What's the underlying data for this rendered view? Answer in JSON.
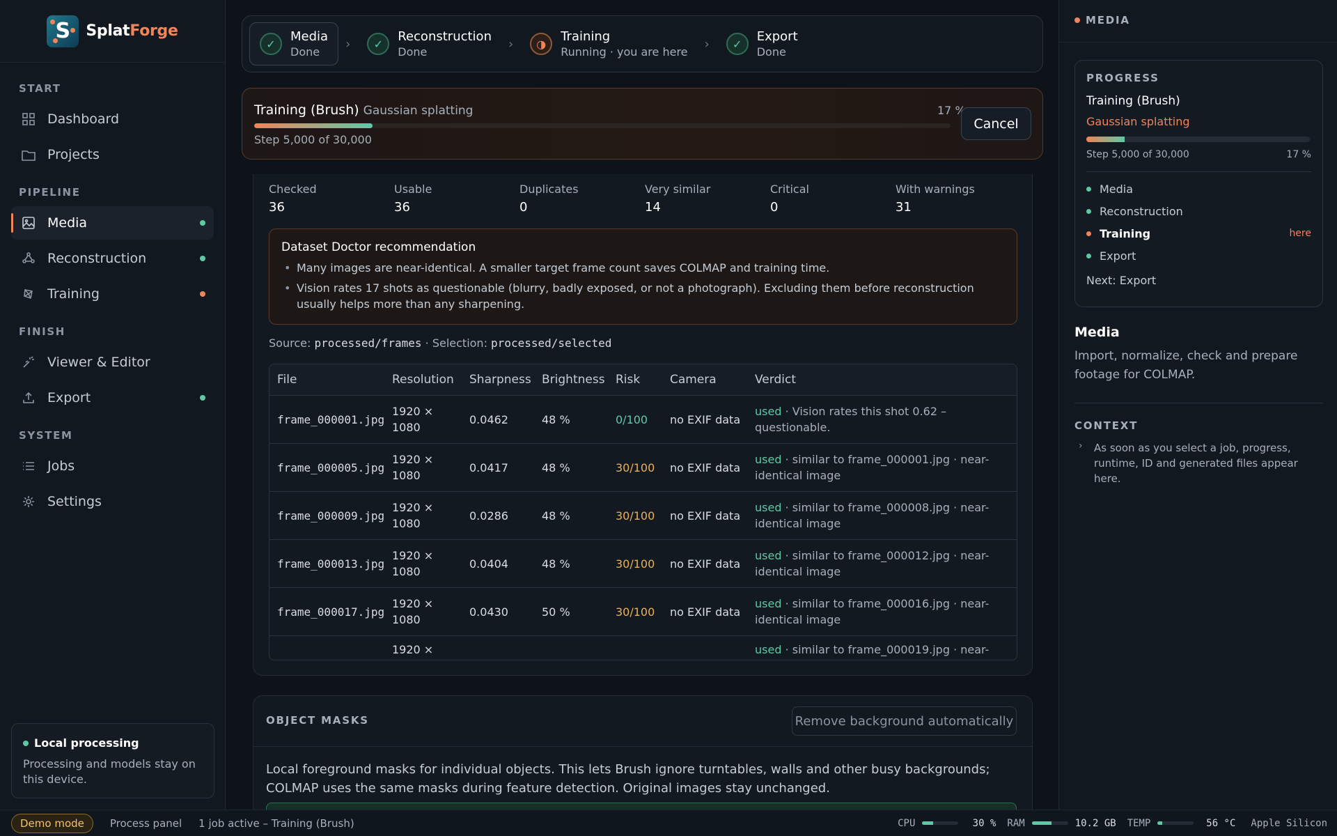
{
  "app": {
    "name_a": "Splat",
    "name_b": "Forge",
    "logo_letter": "S"
  },
  "sidebar": {
    "sections": {
      "start": "START",
      "pipeline": "PIPELINE",
      "finish": "FINISH",
      "system": "SYSTEM"
    },
    "items": [
      {
        "label": "Dashboard",
        "icon": "grid-icon"
      },
      {
        "label": "Projects",
        "icon": "folder-icon"
      },
      {
        "label": "Media",
        "icon": "image-icon",
        "status": "done"
      },
      {
        "label": "Reconstruction",
        "icon": "nodes-icon",
        "status": "done"
      },
      {
        "label": "Training",
        "icon": "brain-icon",
        "status": "running"
      },
      {
        "label": "Viewer & Editor",
        "icon": "wand-icon"
      },
      {
        "label": "Export",
        "icon": "upload-icon",
        "status": "done"
      },
      {
        "label": "Jobs",
        "icon": "list-icon"
      },
      {
        "label": "Settings",
        "icon": "gear-icon"
      }
    ],
    "local": {
      "title": "Local processing",
      "text": "Processing and models stay on this device."
    }
  },
  "stepper": [
    {
      "title": "Media",
      "status": "Done"
    },
    {
      "title": "Reconstruction",
      "status": "Done"
    },
    {
      "title": "Training",
      "status": "Running · you are here"
    },
    {
      "title": "Export",
      "status": "Done"
    }
  ],
  "training": {
    "title": "Training (Brush)",
    "subtitle": "Gaussian splatting",
    "percent_label": "17 %",
    "progress": 0.17,
    "step": "Step 5,000 of 30,000",
    "cancel": "Cancel"
  },
  "stats": [
    {
      "label": "Checked",
      "value": "36"
    },
    {
      "label": "Usable",
      "value": "36"
    },
    {
      "label": "Duplicates",
      "value": "0"
    },
    {
      "label": "Very similar",
      "value": "14"
    },
    {
      "label": "Critical",
      "value": "0"
    },
    {
      "label": "With warnings",
      "value": "31"
    }
  ],
  "doctor": {
    "title": "Dataset Doctor recommendation",
    "items": [
      "Many images are near-identical. A smaller target frame count saves COLMAP and training time.",
      "Vision rates 17 shots as questionable (blurry, badly exposed, or not a photograph). Excluding them before reconstruction usually helps more than any sharpening."
    ]
  },
  "source": {
    "source_label": "Source:",
    "source_path": "processed/frames",
    "sep": "· Selection:",
    "selection_path": "processed/selected"
  },
  "table": {
    "headers": [
      "File",
      "Resolution",
      "Sharpness",
      "Brightness",
      "Risk",
      "Camera",
      "Verdict"
    ],
    "rows": [
      {
        "file": "frame_000001.jpg",
        "res1": "1920 ×",
        "res2": "1080",
        "sharp": "0.0462",
        "bright": "48 %",
        "risk": "0/100",
        "camera": "no EXIF data",
        "verdict": "used",
        "note": " · Vision rates this shot 0.62 – questionable."
      },
      {
        "file": "frame_000005.jpg",
        "res1": "1920 ×",
        "res2": "1080",
        "sharp": "0.0417",
        "bright": "48 %",
        "risk": "30/100",
        "camera": "no EXIF data",
        "verdict": "used",
        "note": " · similar to frame_000001.jpg · near-identical image"
      },
      {
        "file": "frame_000009.jpg",
        "res1": "1920 ×",
        "res2": "1080",
        "sharp": "0.0286",
        "bright": "48 %",
        "risk": "30/100",
        "camera": "no EXIF data",
        "verdict": "used",
        "note": " · similar to frame_000008.jpg · near-identical image"
      },
      {
        "file": "frame_000013.jpg",
        "res1": "1920 ×",
        "res2": "1080",
        "sharp": "0.0404",
        "bright": "48 %",
        "risk": "30/100",
        "camera": "no EXIF data",
        "verdict": "used",
        "note": " · similar to frame_000012.jpg · near-identical image"
      },
      {
        "file": "frame_000017.jpg",
        "res1": "1920 ×",
        "res2": "1080",
        "sharp": "0.0430",
        "bright": "50 %",
        "risk": "30/100",
        "camera": "no EXIF data",
        "verdict": "used",
        "note": " · similar to frame_000016.jpg · near-identical image"
      },
      {
        "file": "",
        "res1": "1920 ×",
        "res2": "",
        "sharp": "",
        "bright": "",
        "risk": "",
        "camera": "",
        "verdict": "used",
        "note": " · similar to frame_000019.jpg · near-"
      }
    ]
  },
  "masks": {
    "title": "OBJECT MASKS",
    "button": "Remove background automatically",
    "text": "Local foreground masks for individual objects. This lets Brush ignore turntables, walls and other busy backgrounds; COLMAP uses the same masks during feature detection. Original images stay unchanged."
  },
  "right": {
    "header": "MEDIA",
    "progress_title": "PROGRESS",
    "job": "Training (Brush)",
    "job_sub": "Gaussian splatting",
    "progress": 0.17,
    "step": "Step 5,000 of 30,000",
    "pct": "17 %",
    "stages": [
      "Media",
      "Reconstruction",
      "Training",
      "Export"
    ],
    "here": "here",
    "next": "Next: Export",
    "media_title": "Media",
    "media_desc": "Import, normalize, check and prepare footage for COLMAP.",
    "context_title": "CONTEXT",
    "context_text": "As soon as you select a job, progress, runtime, ID and generated files appear here."
  },
  "status": {
    "demo": "Demo mode",
    "panel": "Process panel",
    "jobs": "1 job active – Training (Brush)",
    "cpu_label": "CPU",
    "cpu_value": "30 %",
    "cpu_level": 0.3,
    "ram_label": "RAM",
    "ram_value": "10.2 GB",
    "ram_level": 0.55,
    "temp_label": "TEMP",
    "temp_value": "56 °C",
    "temp_level": 0.12,
    "chip": "Apple Silicon"
  },
  "colors": {
    "accent": "#f0845a",
    "ok": "#5fc8a5",
    "warn": "#e8b15a"
  }
}
